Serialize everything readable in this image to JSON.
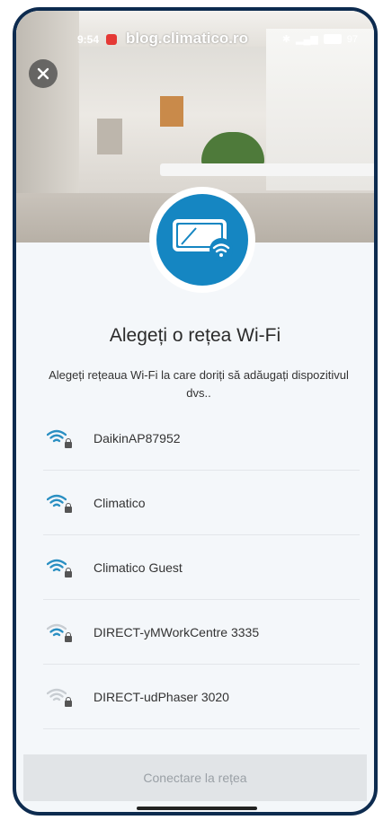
{
  "status_bar": {
    "time": "9:54",
    "watermark": "blog.climatico.ro",
    "battery": "97"
  },
  "header": {
    "close_icon": "close-icon",
    "device_icon": "ac-unit-wifi-icon"
  },
  "main": {
    "title": "Alegeți o rețea Wi-Fi",
    "subtitle": "Alegeți rețeaua Wi-Fi la care doriți să adăugați dispozitivul dvs..",
    "networks": [
      {
        "name": "DaikinAP87952",
        "signal": "strong",
        "secured": true
      },
      {
        "name": "Climatico",
        "signal": "strong",
        "secured": true
      },
      {
        "name": "Climatico Guest",
        "signal": "strong",
        "secured": true
      },
      {
        "name": "DIRECT-yMWorkCentre 3335",
        "signal": "medium",
        "secured": true
      },
      {
        "name": "DIRECT-udPhaser 3020",
        "signal": "weak",
        "secured": true
      }
    ]
  },
  "footer": {
    "connect_label": "Conectare la rețea"
  },
  "colors": {
    "accent": "#1586c2",
    "frame": "#0d2b4f",
    "wifi_strong": "#2a8fc2",
    "wifi_weak": "#c8cdd2"
  }
}
